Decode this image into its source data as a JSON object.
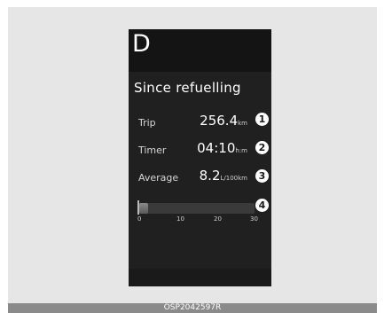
{
  "display": {
    "gear": "D",
    "title": "Since refuelling",
    "rows": [
      {
        "label": "Trip",
        "value": "256.4",
        "unit": "km",
        "callout": "1"
      },
      {
        "label": "Timer",
        "value": "04:10",
        "unit": "h:m",
        "callout": "2"
      },
      {
        "label": "Average",
        "value": "8.2",
        "unit": "L/100km",
        "callout": "3"
      }
    ],
    "fuel_bar": {
      "callout": "4",
      "scale": [
        "0",
        "10",
        "20",
        "30"
      ],
      "level_fraction": 0.08
    }
  },
  "caption": "OSP2042597R",
  "colors": {
    "screen_bg": "#202020",
    "text": "#ffffff",
    "caption_bg": "#8a8a8a"
  }
}
